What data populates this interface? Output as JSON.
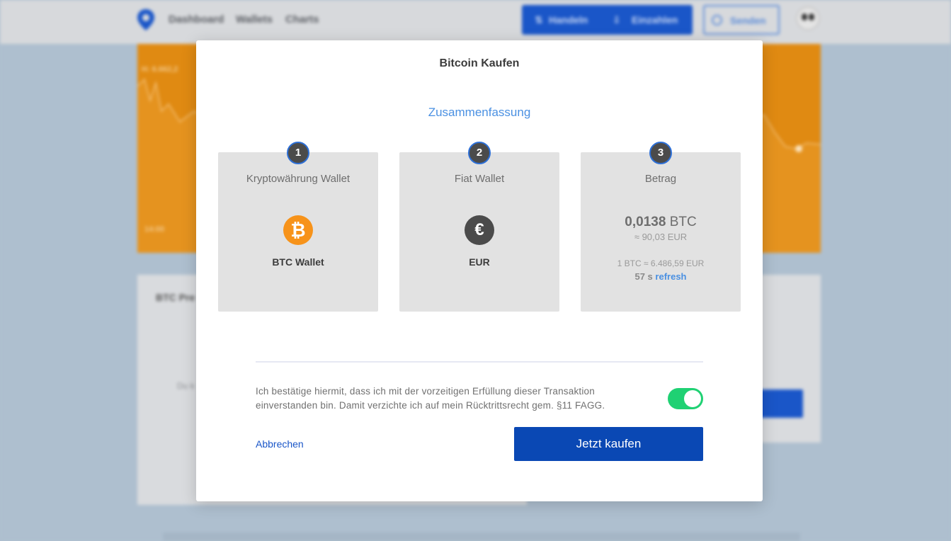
{
  "background": {
    "nav": [
      "Dashboard",
      "Wallets",
      "Charts"
    ],
    "actions": {
      "trade": "Handeln",
      "deposit": "Einzahlen",
      "send": "Senden"
    },
    "chart": {
      "high_label": "H: 6.662,2",
      "time_label": "14:00"
    },
    "price_card_title": "BTC Pre",
    "price_card_text": "Du k"
  },
  "modal": {
    "title": "Bitcoin Kaufen",
    "subtitle": "Zusammenfassung",
    "steps": [
      {
        "number": "1",
        "label": "Kryptowährung Wallet",
        "value": "BTC Wallet",
        "icon": "bitcoin-icon"
      },
      {
        "number": "2",
        "label": "Fiat Wallet",
        "value": "EUR",
        "icon": "euro-icon"
      },
      {
        "number": "3",
        "label": "Betrag"
      }
    ],
    "amount": {
      "crypto_value": "0,0138",
      "crypto_unit": "BTC",
      "fiat_equivalent": "≈ 90,03 EUR",
      "rate": "1 BTC ≈ 6.486,59 EUR",
      "timer": "57 s",
      "refresh_label": "refresh"
    },
    "confirmation_text": "Ich bestätige hiermit, dass ich mit der vorzeitigen Erfüllung dieser Transaktion einverstanden bin. Damit verzichte ich auf mein Rücktrittsrecht gem. §11 FAGG.",
    "toggle_on": true,
    "cancel_label": "Abbrechen",
    "buy_label": "Jetzt kaufen"
  },
  "colors": {
    "primary": "#0a48b4",
    "accent_link": "#4a90e2",
    "toggle_on": "#1fd173",
    "bitcoin": "#f7931a",
    "chart_bg": "#e08a12"
  }
}
